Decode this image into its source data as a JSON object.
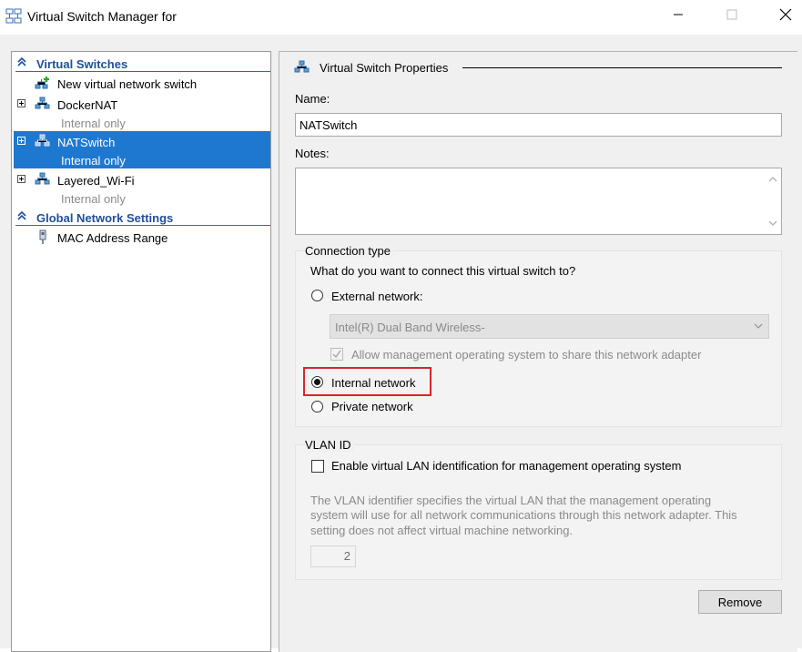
{
  "window": {
    "title": "Virtual Switch Manager for",
    "minimize_icon": "minimize-icon",
    "maximize_icon": "maximize-icon",
    "close_icon": "close-icon"
  },
  "sidebar": {
    "virtual_switches_header": "Virtual Switches",
    "items": [
      {
        "name": "New virtual network switch",
        "subtitle": ""
      },
      {
        "name": "DockerNAT",
        "subtitle": "Internal only"
      },
      {
        "name": "NATSwitch",
        "subtitle": "Internal only",
        "selected": true
      },
      {
        "name": "Layered_Wi-Fi",
        "subtitle": "Internal only"
      }
    ],
    "global_header": "Global Network Settings",
    "global_items": [
      {
        "name": "MAC Address Range"
      }
    ]
  },
  "properties": {
    "section_title": "Virtual Switch Properties",
    "name_label": "Name:",
    "name_value": "NATSwitch",
    "notes_label": "Notes:",
    "notes_value": "",
    "connection": {
      "group_title": "Connection type",
      "question": "What do you want to connect this virtual switch to?",
      "external_label": "External network:",
      "adapter_selected": "Intel(R) Dual Band Wireless-",
      "allow_mgmt_label": "Allow management operating system to share this network adapter",
      "internal_label": "Internal network",
      "private_label": "Private network",
      "selected": "internal"
    },
    "vlan": {
      "group_title": "VLAN ID",
      "enable_label": "Enable virtual LAN identification for management operating system",
      "desc_line1": "The VLAN identifier specifies the virtual LAN that the management operating",
      "desc_line2": "system will use for all network communications through this network adapter. This",
      "desc_line3": "setting does not affect virtual machine networking.",
      "vlan_value": "2"
    },
    "remove_label": "Remove"
  },
  "colors": {
    "selection": "#1f78d0",
    "header_text": "#1f4e9c",
    "highlight_border": "#d9252a"
  }
}
